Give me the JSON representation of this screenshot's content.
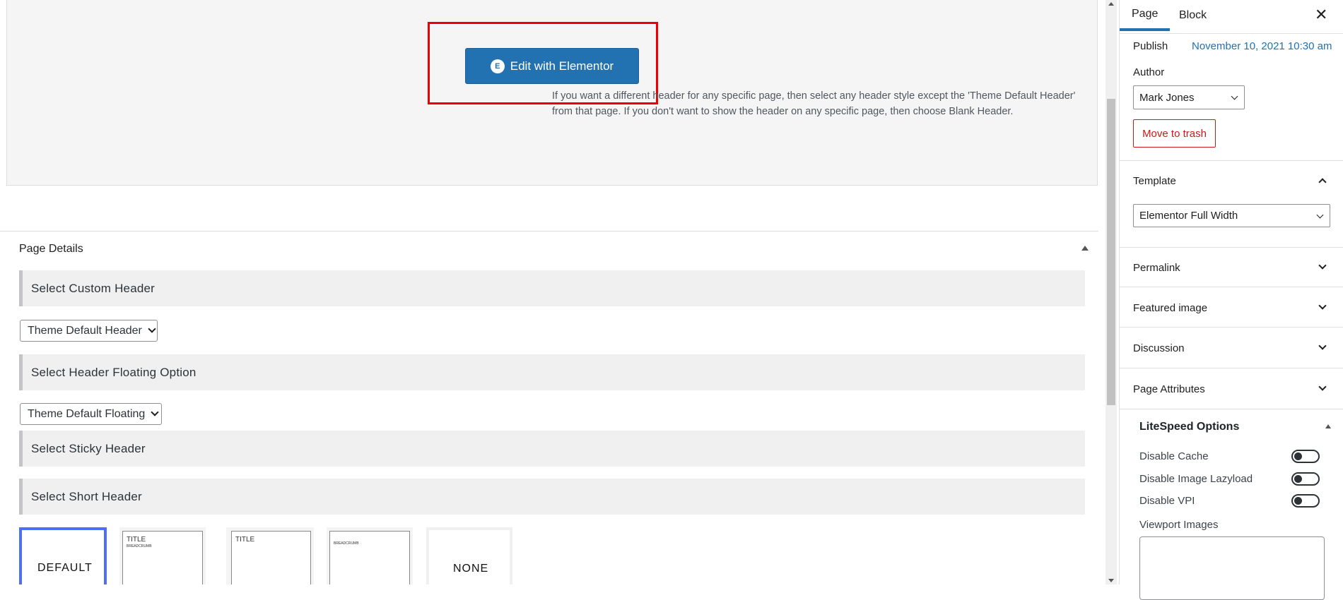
{
  "editor": {
    "edit_button_label": "Edit with Elementor",
    "edit_button_icon": "elementor-icon",
    "highlight_color": "#e00000"
  },
  "page_details": {
    "title": "Page Details",
    "custom_header_title": "Select Custom Header",
    "custom_header_value": "Theme Default Header",
    "custom_header_help": "If you want a different header for any specific page, then select any header style except the 'Theme Default Header' from that page. If you don't want to show the header on any specific page, then choose Blank Header.",
    "floating_title": "Select Header Floating Option",
    "floating_value": "Theme Default Floating",
    "sticky_title": "Select Sticky Header",
    "short_header_title": "Select Short Header",
    "short_header_options": {
      "default_label": "DEFAULT",
      "opt2_title": "TITLE",
      "opt2_breadcrumb": "BREADCRUMB",
      "opt3_title": "TITLE",
      "opt4_breadcrumb": "BREADCRUMB",
      "none_label": "NONE"
    },
    "selected_color": "#4f6ef7"
  },
  "sidebar": {
    "tabs": {
      "page": "Page",
      "block": "Block"
    },
    "close_label": "✕",
    "publish_label": "Publish",
    "publish_date": "November 10, 2021 10:30 am",
    "author_label": "Author",
    "author_value": "Mark Jones",
    "trash_label": "Move to trash",
    "template_label": "Template",
    "template_value": "Elementor Full Width",
    "panels": {
      "permalink": "Permalink",
      "featured_image": "Featured image",
      "discussion": "Discussion",
      "page_attributes": "Page Attributes"
    },
    "litespeed": {
      "title": "LiteSpeed Options",
      "disable_cache": "Disable Cache",
      "disable_lazyload": "Disable Image Lazyload",
      "disable_vpi": "Disable VPI",
      "viewport_images": "Viewport Images"
    },
    "accent_color": "#2271b1",
    "danger_color": "#cc1818"
  }
}
